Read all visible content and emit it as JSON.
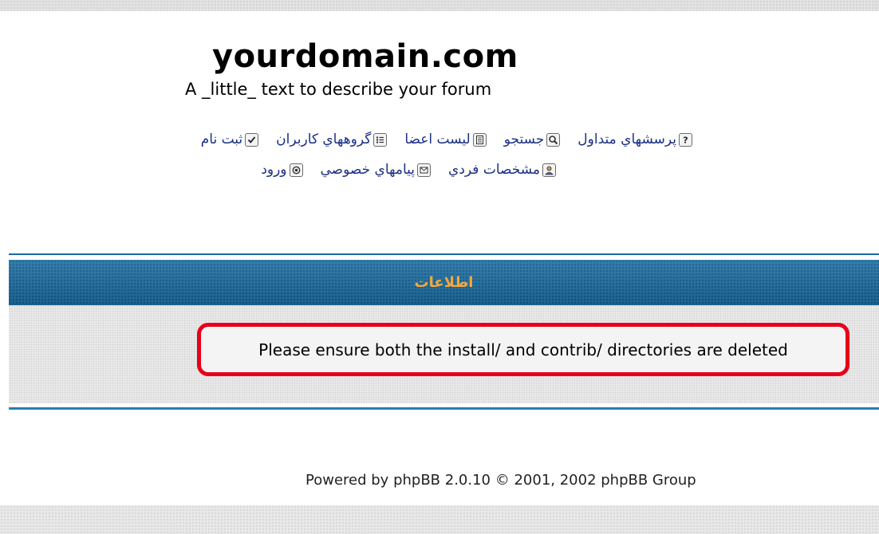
{
  "header": {
    "site_title": "yourdomain.com",
    "site_description": "A _little_ text to describe your forum"
  },
  "nav": {
    "row1": [
      {
        "label": "پرسشهاي متداول",
        "icon": "help-question-icon"
      },
      {
        "label": "جستجو",
        "icon": "search-magnifier-icon"
      },
      {
        "label": "ليست اعضا",
        "icon": "member-list-icon"
      },
      {
        "label": "گروههاي كاربران",
        "icon": "usergroups-icon"
      },
      {
        "label": "ثبت نام",
        "icon": "register-checkbox-icon"
      }
    ],
    "row2": [
      {
        "label": "مشخصات فردي",
        "icon": "profile-person-icon"
      },
      {
        "label": "پيامهاي خصوصي",
        "icon": "private-messages-icon"
      },
      {
        "label": "ورود",
        "icon": "login-icon"
      }
    ]
  },
  "panel": {
    "title": "اطلاعات",
    "message": "Please ensure both the install/ and contrib/ directories are deleted",
    "header_color": "#1f6fa2",
    "title_color": "#f4a93c",
    "highlight_color": "#e8001a"
  },
  "footer": {
    "text_prefix": "Powered by",
    "link_text": "phpBB 2.0.10",
    "text_suffix": "© 2001, 2002 phpBB Group"
  }
}
